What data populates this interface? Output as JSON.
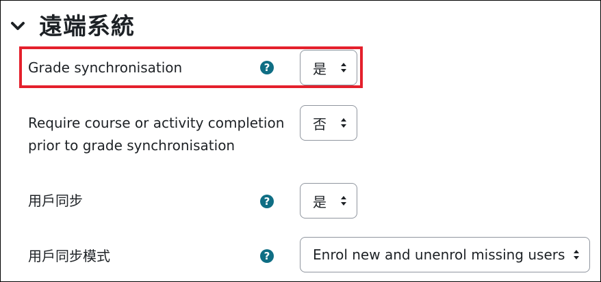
{
  "section": {
    "title": "遠端系統",
    "collapse_icon": "chevron-down-icon"
  },
  "settings": [
    {
      "label": "Grade synchronisation",
      "has_help": true,
      "value": "是",
      "highlighted": true
    },
    {
      "label_line1": "Require course or activity completion",
      "label_line2": "prior to grade synchronisation",
      "has_help": false,
      "value": "否"
    },
    {
      "label": "用戶同步",
      "has_help": true,
      "value": "是"
    },
    {
      "label": "用戶同步模式",
      "has_help": true,
      "value": "Enrol new and unenrol missing users"
    }
  ],
  "colors": {
    "help_icon": "#0f6e84",
    "highlight_border": "#e4202c",
    "select_border": "#8f959e"
  }
}
